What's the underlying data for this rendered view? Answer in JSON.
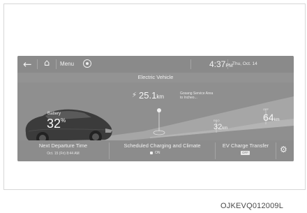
{
  "topbar": {
    "back_icon": "back-arrow-icon",
    "home_icon": "home-icon",
    "menu_label": "Menu",
    "settings_icon": "settings-circle-icon",
    "clock": "4:37",
    "clock_suffix": "PM",
    "date": "Thu, Oct. 14"
  },
  "title": "Electric Vehicle",
  "battery": {
    "label": "Battery",
    "value": "32",
    "unit": "%"
  },
  "range": {
    "current_value": "25.1",
    "current_unit": "km",
    "poi_label": "Gosang Service Area to Incheo...",
    "mid_value": "32",
    "mid_unit": "km",
    "mid_tag": "ECO",
    "far_value": "64",
    "far_unit": "km",
    "far_tag": "OFF"
  },
  "panels": {
    "departure_label": "Next Departure Time",
    "departure_sub": "Oct. 15 (Fri) 8:44 AM",
    "charging_label": "Scheduled Charging and Climate",
    "charging_status": "ON",
    "v2l_label": "EV Charge Transfer",
    "v2l_status": "OFF"
  },
  "watermark": "OJKEVQ012009L",
  "colors": {
    "screen_bg": "#8f8f8f",
    "text": "#f4f4f4",
    "road": "#a8a8a8"
  }
}
